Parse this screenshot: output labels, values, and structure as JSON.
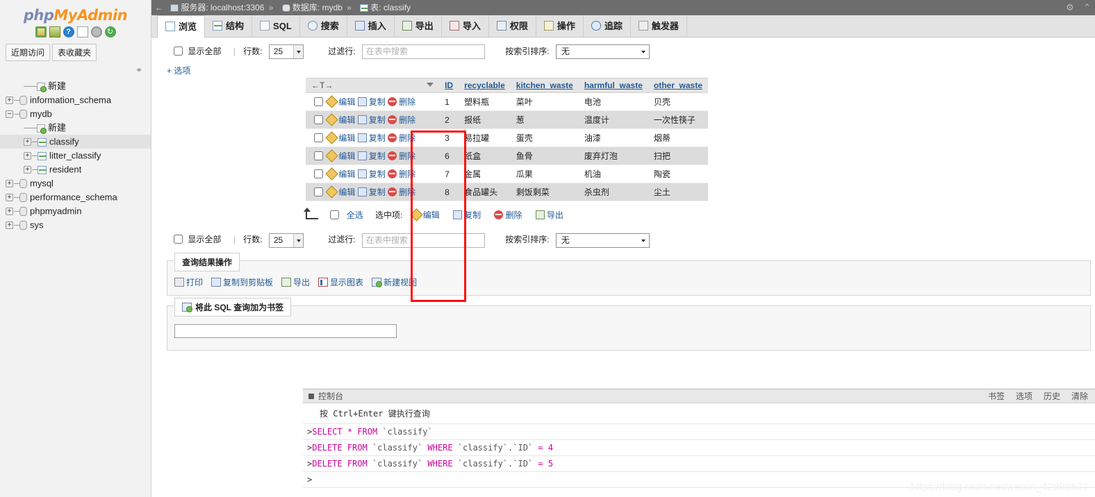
{
  "sidebar": {
    "logo": {
      "php": "php",
      "my": "My",
      "admin": "Admin"
    },
    "logo_icons": [
      {
        "name": "home-icon",
        "glyph": ""
      },
      {
        "name": "server-exit-icon",
        "glyph": ""
      },
      {
        "name": "help-icon",
        "glyph": "?"
      },
      {
        "name": "docs-icon",
        "glyph": ""
      },
      {
        "name": "settings-icon",
        "glyph": ""
      },
      {
        "name": "refresh-icon",
        "glyph": "↻"
      }
    ],
    "quick_tabs": [
      {
        "label": "近期访问"
      },
      {
        "label": "表收藏夹"
      }
    ],
    "tree": [
      {
        "label": "新建",
        "type": "new",
        "depth": 1,
        "expander": "",
        "selected": false
      },
      {
        "label": "information_schema",
        "type": "db",
        "depth": 0,
        "expander": "+",
        "selected": false
      },
      {
        "label": "mydb",
        "type": "db",
        "depth": 0,
        "expander": "−",
        "selected": false
      },
      {
        "label": "新建",
        "type": "newtable",
        "depth": 1,
        "expander": "",
        "selected": false
      },
      {
        "label": "classify",
        "type": "table",
        "depth": 1,
        "expander": "+",
        "selected": true
      },
      {
        "label": "litter_classify",
        "type": "table",
        "depth": 1,
        "expander": "+",
        "selected": false
      },
      {
        "label": "resident",
        "type": "table",
        "depth": 1,
        "expander": "+",
        "selected": false
      },
      {
        "label": "mysql",
        "type": "db",
        "depth": 0,
        "expander": "+",
        "selected": false
      },
      {
        "label": "performance_schema",
        "type": "db",
        "depth": 0,
        "expander": "+",
        "selected": false
      },
      {
        "label": "phpmyadmin",
        "type": "db",
        "depth": 0,
        "expander": "+",
        "selected": false
      },
      {
        "label": "sys",
        "type": "db",
        "depth": 0,
        "expander": "+",
        "selected": false
      }
    ]
  },
  "breadcrumb": {
    "back": "←",
    "server_label": "服务器: localhost:3306",
    "db_label": "数据库: mydb",
    "table_label": "表: classify",
    "separator": "»",
    "right_icons": [
      {
        "name": "settings-gear-icon",
        "glyph": "⚙"
      },
      {
        "name": "collapse-icon",
        "glyph": "⌃"
      }
    ]
  },
  "tabs": [
    {
      "label": "浏览",
      "icon": "browse-icon",
      "active": true
    },
    {
      "label": "结构",
      "icon": "structure-icon",
      "active": false
    },
    {
      "label": "SQL",
      "icon": "sql-icon",
      "active": false
    },
    {
      "label": "搜索",
      "icon": "search-icon",
      "active": false
    },
    {
      "label": "插入",
      "icon": "insert-icon",
      "active": false
    },
    {
      "label": "导出",
      "icon": "export-icon",
      "active": false
    },
    {
      "label": "导入",
      "icon": "import-icon",
      "active": false
    },
    {
      "label": "权限",
      "icon": "privileges-icon",
      "active": false
    },
    {
      "label": "操作",
      "icon": "operations-icon",
      "active": false
    },
    {
      "label": "追踪",
      "icon": "tracking-icon",
      "active": false
    },
    {
      "label": "触发器",
      "icon": "triggers-icon",
      "active": false
    }
  ],
  "controls": {
    "show_all_label": "显示全部",
    "rows_label": "行数:",
    "rows_value": "25",
    "filter_label": "过滤行:",
    "filter_placeholder": "在表中搜索",
    "filter_value": "",
    "sort_label": "按索引排序:",
    "sort_value": "无"
  },
  "options_link": "+ 选项",
  "table": {
    "nav_marks": "←T→",
    "columns": [
      "ID",
      "recyclable",
      "kitchen_waste",
      "harmful_waste",
      "other_waste"
    ],
    "row_actions": {
      "edit": "编辑",
      "copy": "复制",
      "delete": "删除"
    },
    "rows": [
      {
        "id": "1",
        "recyclable": "塑料瓶",
        "kitchen_waste": "菜叶",
        "harmful_waste": "电池",
        "other_waste": "贝壳"
      },
      {
        "id": "2",
        "recyclable": "报纸",
        "kitchen_waste": "葱",
        "harmful_waste": "温度计",
        "other_waste": "一次性筷子"
      },
      {
        "id": "3",
        "recyclable": "易拉罐",
        "kitchen_waste": "蛋壳",
        "harmful_waste": "油漆",
        "other_waste": "烟蒂"
      },
      {
        "id": "6",
        "recyclable": "纸盒",
        "kitchen_waste": "鱼骨",
        "harmful_waste": "废弃灯泡",
        "other_waste": "扫把"
      },
      {
        "id": "7",
        "recyclable": "金属",
        "kitchen_waste": "瓜果",
        "harmful_waste": "机油",
        "other_waste": "陶瓷"
      },
      {
        "id": "8",
        "recyclable": "食品罐头",
        "kitchen_waste": "剩饭剩菜",
        "harmful_waste": "杀虫剂",
        "other_waste": "尘土"
      }
    ]
  },
  "bulk_actions": {
    "check_all_label": "全选",
    "selected_label": "选中项:",
    "edit": "编辑",
    "copy": "复制",
    "delete": "删除",
    "export": "导出"
  },
  "query_results": {
    "legend": "查询结果操作",
    "links": [
      {
        "label": "打印",
        "icon": "print-icon"
      },
      {
        "label": "复制到剪贴板",
        "icon": "clipboard-icon"
      },
      {
        "label": "导出",
        "icon": "export-icon"
      },
      {
        "label": "显示图表",
        "icon": "chart-icon"
      },
      {
        "label": "新建视图",
        "icon": "new-view-icon"
      }
    ]
  },
  "bookmark": {
    "legend": "将此 SQL 查询加为书签",
    "icon": "bookmark-icon"
  },
  "console": {
    "title": "控制台",
    "right_links": [
      "书签",
      "选项",
      "历史",
      "清除"
    ],
    "hint": "按 Ctrl+Enter 键执行查询",
    "lines": [
      {
        "prompt": ">",
        "tokens": [
          {
            "t": "SELECT ",
            "c": "kw"
          },
          {
            "t": "* ",
            "c": "op"
          },
          {
            "t": "FROM ",
            "c": "kw"
          },
          {
            "t": "`classify`",
            "c": "id"
          }
        ]
      },
      {
        "prompt": ">",
        "tokens": [
          {
            "t": "DELETE ",
            "c": "kw"
          },
          {
            "t": "FROM ",
            "c": "kw"
          },
          {
            "t": "`classify` ",
            "c": "id"
          },
          {
            "t": "WHERE ",
            "c": "kw"
          },
          {
            "t": "`classify`.`ID` ",
            "c": "id"
          },
          {
            "t": "= ",
            "c": "op"
          },
          {
            "t": "4",
            "c": "num"
          }
        ]
      },
      {
        "prompt": ">",
        "tokens": [
          {
            "t": "DELETE ",
            "c": "kw"
          },
          {
            "t": "FROM ",
            "c": "kw"
          },
          {
            "t": "`classify` ",
            "c": "id"
          },
          {
            "t": "WHERE ",
            "c": "kw"
          },
          {
            "t": "`classify`.`ID` ",
            "c": "id"
          },
          {
            "t": "= ",
            "c": "op"
          },
          {
            "t": "5",
            "c": "num"
          }
        ]
      },
      {
        "prompt": ">",
        "tokens": []
      }
    ]
  },
  "annotation": {
    "name": "red-highlight-box",
    "color": "#fd0d0d"
  },
  "watermark": "https://blog.csdn.net/weixin_42899627"
}
